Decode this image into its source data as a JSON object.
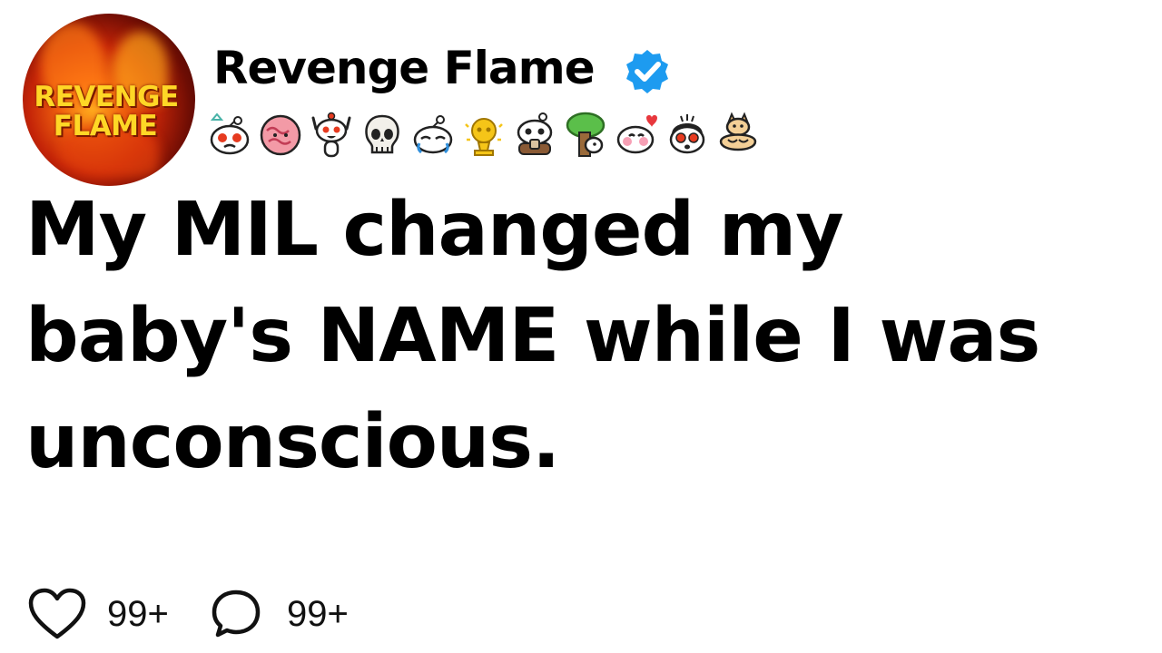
{
  "profile": {
    "logo_line1": "REVENGE",
    "logo_line2": "FLAME",
    "name": "Revenge Flame",
    "verified_icon": "verified-badge-icon",
    "badge_color": "#1d9bf0",
    "awards": [
      "snoo-crying-award-icon",
      "brain-award-icon",
      "snoo-cheer-award-icon",
      "skull-award-icon",
      "snoo-sleepy-award-icon",
      "gold-trophy-award-icon",
      "snoo-coffee-award-icon",
      "tree-hug-award-icon",
      "snoo-heart-eyes-award-icon",
      "snoo-shocked-award-icon",
      "buff-doge-award-icon"
    ]
  },
  "post": {
    "title": "My MIL changed my baby's NAME while I was unconscious."
  },
  "actions": {
    "likes": "99+",
    "comments": "99+"
  }
}
